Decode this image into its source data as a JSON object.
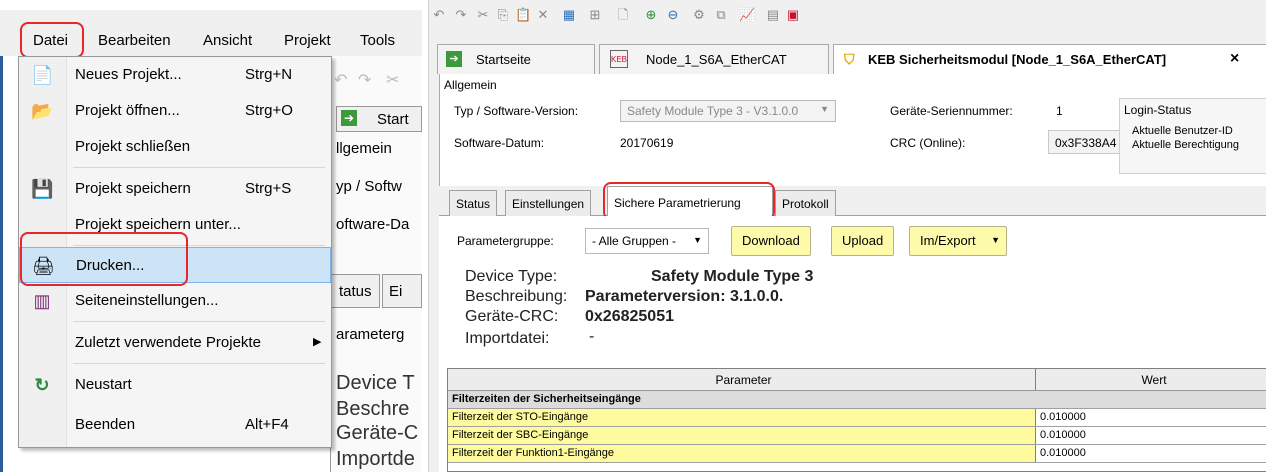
{
  "left": {
    "menubar": {
      "items": [
        "Datei",
        "Bearbeiten",
        "Ansicht",
        "Projekt",
        "Tools"
      ]
    },
    "menu": {
      "items": [
        {
          "label": "Neues Projekt...",
          "shortcut": "Strg+N",
          "icon": "new-project-icon"
        },
        {
          "label": "Projekt öffnen...",
          "shortcut": "Strg+O",
          "icon": "open-folder-icon"
        },
        {
          "label": "Projekt schließen",
          "shortcut": "",
          "icon": ""
        },
        {
          "label": "Projekt speichern",
          "shortcut": "Strg+S",
          "icon": "floppy-disk-icon"
        },
        {
          "label": "Projekt speichern unter...",
          "shortcut": "",
          "icon": ""
        },
        {
          "label": "Drucken...",
          "shortcut": "",
          "icon": "printer-icon"
        },
        {
          "label": "Seiteneinstellungen...",
          "shortcut": "",
          "icon": "page-setup-icon"
        },
        {
          "label": "Zuletzt verwendete Projekte",
          "shortcut": "",
          "icon": ""
        },
        {
          "label": "Neustart",
          "shortcut": "",
          "icon": "restart-icon"
        },
        {
          "label": "Beenden",
          "shortcut": "Alt+F4",
          "icon": ""
        }
      ]
    },
    "background": {
      "tab_start": "Start",
      "allgemein": "llgemein",
      "typ": "yp / Softw",
      "software": "oftware-Da",
      "status": "tatus",
      "ei": "Ei",
      "param": "arameterg",
      "device": "Device T",
      "beschre": "Beschre",
      "geraete": "Geräte-C",
      "import": "Importde"
    }
  },
  "right": {
    "tabs": [
      "Startseite",
      "Node_1_S6A_EtherCAT",
      "KEB Sicherheitsmodul [Node_1_S6A_EtherCAT]"
    ],
    "tab_close": "×",
    "allgemein": "Allgemein",
    "typ_label": "Typ / Software-Version:",
    "typ_value": "Safety Module Type 3 - V3.1.0.0",
    "software_label": "Software-Datum:",
    "software_value": "20170619",
    "serial_label": "Geräte-Seriennummer:",
    "serial_value": "1",
    "crc_label": "CRC (Online):",
    "crc_value": "0x3F338A4",
    "login": {
      "title": "Login-Status",
      "line1": "Aktuelle Benutzer-ID",
      "line2": "Aktuelle Berechtigung"
    },
    "subtabs": [
      "Status",
      "Einstellungen",
      "Sichere Parametrierung",
      "Protokoll"
    ],
    "param_group_label": "Parametergruppe:",
    "param_group_value": "- Alle Gruppen -",
    "buttons": {
      "download": "Download",
      "upload": "Upload",
      "imexport": "Im/Export"
    },
    "info": {
      "device_label": "Device Type:",
      "device_value": "Safety Module Type 3",
      "desc_label": "Beschreibung:",
      "desc_value": "Parameterversion: 3.1.0.0.",
      "crc_label": "Geräte-CRC:",
      "crc_value": "0x26825051",
      "import_label": "Importdatei:",
      "import_value": "-"
    },
    "grid": {
      "headers": [
        "Parameter",
        "Wert"
      ],
      "group": "Filterzeiten der Sicherheitseingänge",
      "rows": [
        {
          "name": "Filterzeit der STO-Eingänge",
          "value": "0.010000"
        },
        {
          "name": "Filterzeit der SBC-Eingänge",
          "value": "0.010000"
        },
        {
          "name": "Filterzeit der Funktion1-Eingänge",
          "value": "0.010000"
        }
      ]
    }
  },
  "colors": {
    "highlight": "#e8262c",
    "button_yellow": "#fdfbaa",
    "row_yellow": "#fdfb9d",
    "selection": "#cde4f7"
  }
}
